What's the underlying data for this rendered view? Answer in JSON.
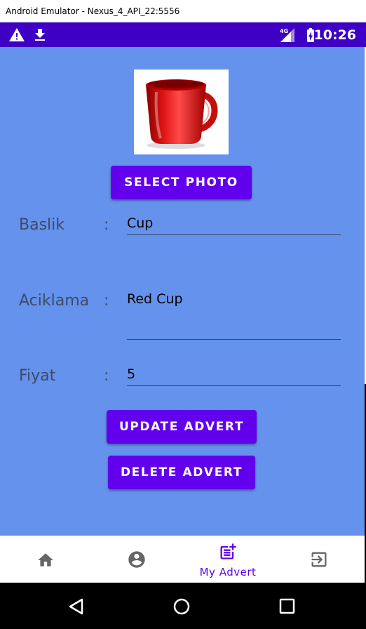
{
  "window": {
    "title": "Android Emulator - Nexus_4_API_22:5556"
  },
  "status_bar": {
    "time": "10:26",
    "network": "4G"
  },
  "form": {
    "select_photo_label": "SELECT PHOTO",
    "title_label": "Baslik",
    "title_value": "Cup",
    "description_label": "Aciklama",
    "description_value": "Red Cup",
    "price_label": "Fiyat",
    "price_value": "5",
    "separator": ":",
    "update_label": "UPDATE ADVERT",
    "delete_label": "DELETE ADVERT"
  },
  "bottom_nav": {
    "items": [
      {
        "icon": "home-icon",
        "label": ""
      },
      {
        "icon": "account-icon",
        "label": ""
      },
      {
        "icon": "post-add-icon",
        "label": "My Advert"
      },
      {
        "icon": "exit-icon",
        "label": ""
      }
    ]
  },
  "colors": {
    "status_bar": "#3d00c4",
    "content_bg": "#6492ec",
    "accent": "#6200ee"
  }
}
